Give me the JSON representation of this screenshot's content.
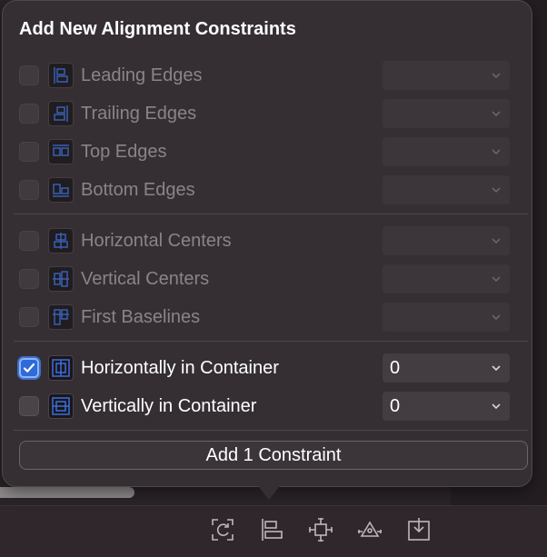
{
  "popover": {
    "title": "Add New Alignment Constraints",
    "groups": [
      [
        {
          "label": "Leading Edges",
          "checked": false,
          "enabled": false,
          "icon": "leading-edges-icon",
          "value": ""
        },
        {
          "label": "Trailing Edges",
          "checked": false,
          "enabled": false,
          "icon": "trailing-edges-icon",
          "value": ""
        },
        {
          "label": "Top Edges",
          "checked": false,
          "enabled": false,
          "icon": "top-edges-icon",
          "value": ""
        },
        {
          "label": "Bottom Edges",
          "checked": false,
          "enabled": false,
          "icon": "bottom-edges-icon",
          "value": ""
        }
      ],
      [
        {
          "label": "Horizontal Centers",
          "checked": false,
          "enabled": false,
          "icon": "horizontal-centers-icon",
          "value": ""
        },
        {
          "label": "Vertical Centers",
          "checked": false,
          "enabled": false,
          "icon": "vertical-centers-icon",
          "value": ""
        },
        {
          "label": "First Baselines",
          "checked": false,
          "enabled": false,
          "icon": "first-baselines-icon",
          "value": ""
        }
      ],
      [
        {
          "label": "Horizontally in Container",
          "checked": true,
          "enabled": true,
          "icon": "horizontally-in-container-icon",
          "value": "0"
        },
        {
          "label": "Vertically in Container",
          "checked": false,
          "enabled": true,
          "icon": "vertically-in-container-icon",
          "value": "0"
        }
      ]
    ],
    "add_button_label": "Add 1 Constraint"
  },
  "bottom_toolbar": {
    "icons": [
      "update-frames-icon",
      "align-icon",
      "add-constraints-icon",
      "resolve-issues-icon",
      "embed-in-icon"
    ]
  },
  "colors": {
    "accent": "#2f6bd6",
    "icon_blue": "#3b6fe0",
    "popover_bg": "#352f33"
  }
}
